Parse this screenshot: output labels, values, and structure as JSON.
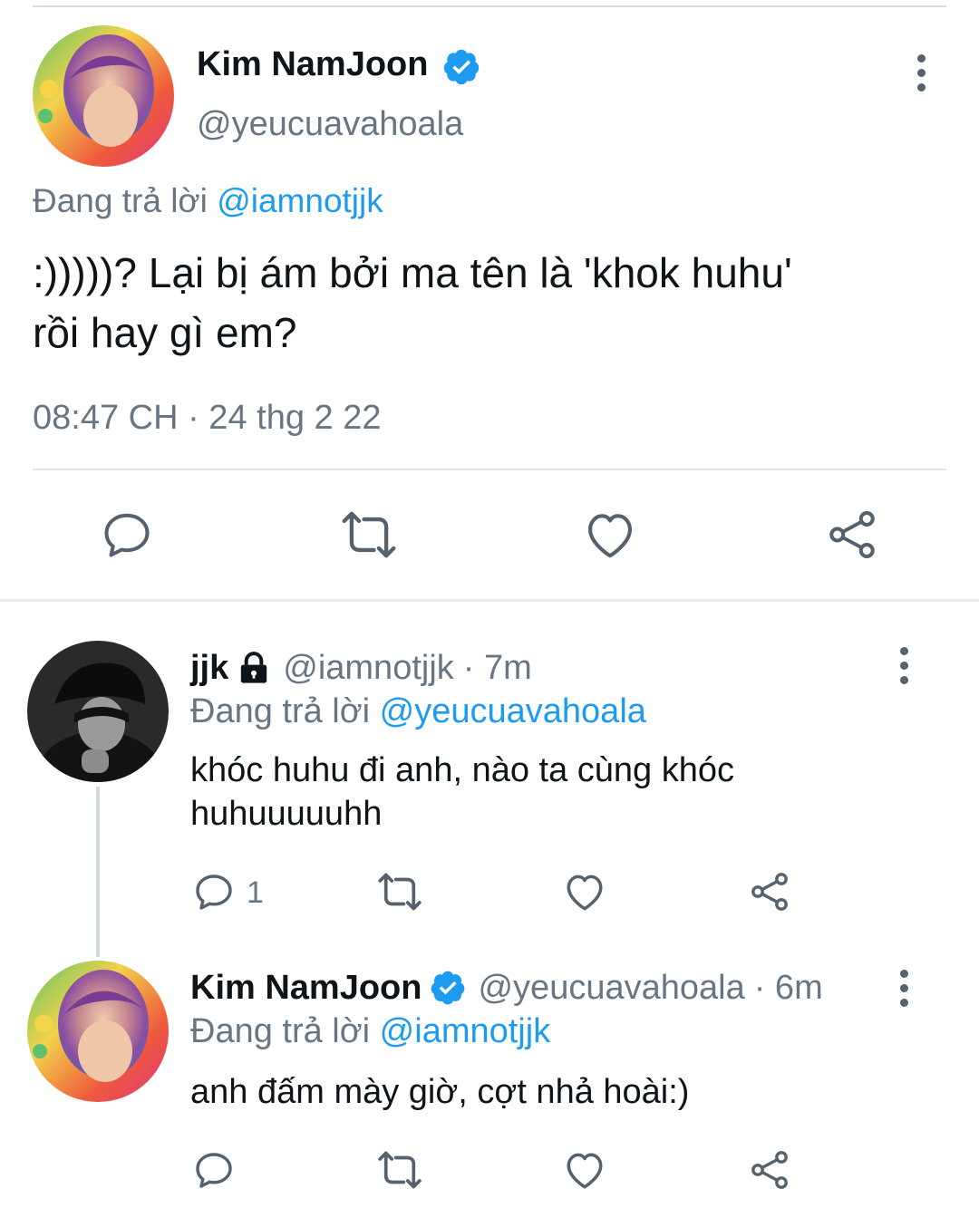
{
  "main_tweet": {
    "display_name": "Kim NamJoon",
    "handle": "@yeucuavahoala",
    "reply_prefix": "Đang trả lời",
    "reply_to": "@iamnotjjk",
    "text_line1": ":)))))? Lại bị ám bởi ma tên là 'khok huhu'",
    "text_line2": "rồi hay gì em?",
    "timestamp": "08:47 CH · 24 thg 2 22"
  },
  "replies": [
    {
      "display_name": "jjk",
      "handle": "@iamnotjjk",
      "time": "· 7m",
      "reply_prefix": "Đang trả lời",
      "reply_to": "@yeucuavahoala",
      "text_line1": "khóc huhu đi anh, nào ta cùng khóc",
      "text_line2": "huhuuuuuhh",
      "reply_count": "1",
      "locked": true
    },
    {
      "display_name": "Kim NamJoon",
      "handle": "@yeucuavahoala",
      "time": "· 6m",
      "reply_prefix": "Đang trả lời",
      "reply_to": "@iamnotjjk",
      "text_line1": "anh đấm mày giờ, cợt nhả hoài:)",
      "verified": true
    }
  ],
  "icons": [
    "verified-badge-icon",
    "more-options-icon",
    "reply-icon",
    "retweet-icon",
    "like-icon",
    "share-icon",
    "lock-icon"
  ],
  "colors": {
    "accent": "#1d9bf0",
    "muted_text": "#687684",
    "icon": "#55616c",
    "divider": "#dfe4e8"
  }
}
